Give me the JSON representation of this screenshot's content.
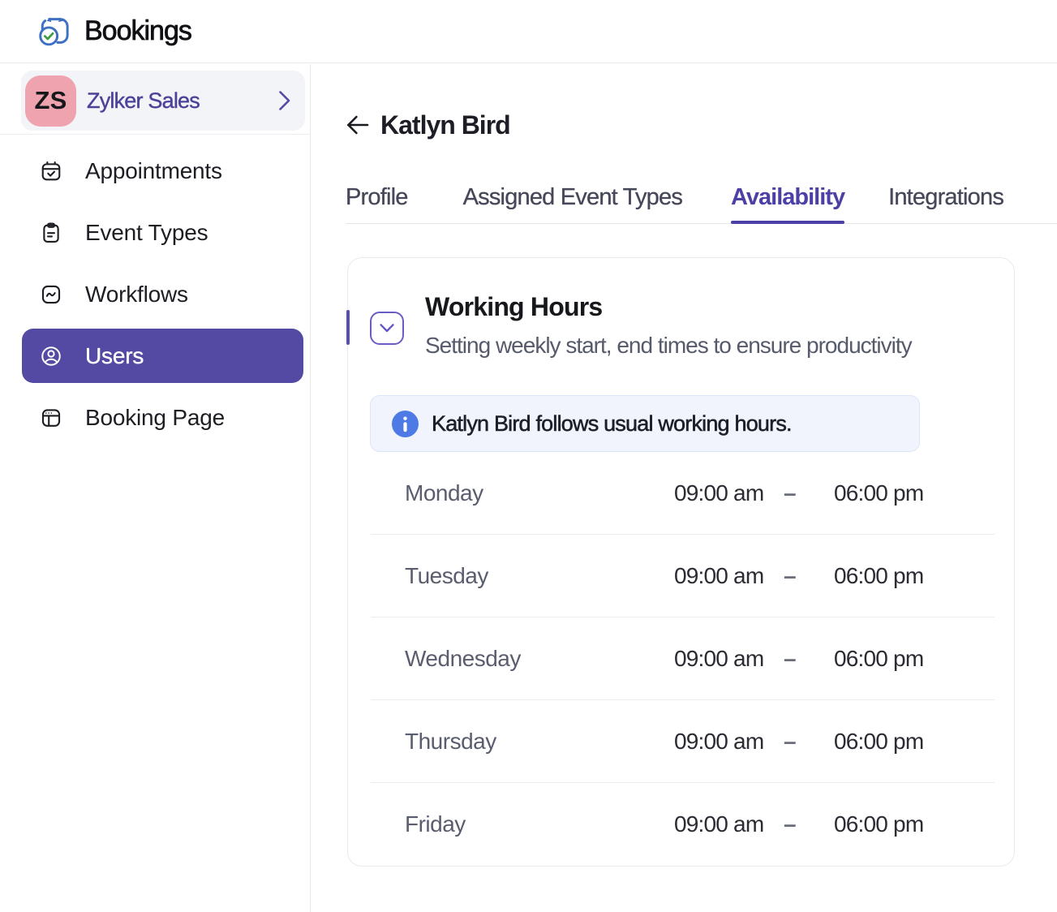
{
  "app": {
    "title": "Bookings"
  },
  "colors": {
    "primary_purple": "#544aa3",
    "tab_active_purple": "#4c3fa5",
    "avatar_pink": "#efa3ae",
    "notice_blue_bg": "#f1f4fc",
    "info_icon_blue": "#4d7ae5",
    "logo_blue": "#3d6fc3",
    "logo_check_green": "#3f9c42"
  },
  "sidebar": {
    "workspace": {
      "initials": "ZS",
      "name": "Zylker Sales"
    },
    "items": [
      {
        "label": "Appointments",
        "selected": false
      },
      {
        "label": "Event Types",
        "selected": false
      },
      {
        "label": "Workflows",
        "selected": false
      },
      {
        "label": "Users",
        "selected": true
      },
      {
        "label": "Booking Page",
        "selected": false
      }
    ]
  },
  "page": {
    "title": "Katlyn Bird"
  },
  "tabs": [
    {
      "label": "Profile",
      "active": false
    },
    {
      "label": "Assigned Event Types",
      "active": false
    },
    {
      "label": "Availability",
      "active": true
    },
    {
      "label": "Integrations",
      "active": false
    }
  ],
  "working_hours": {
    "title": "Working Hours",
    "subtitle": "Setting weekly start, end times to ensure productivity",
    "notice": "Katlyn Bird follows usual working hours.",
    "rows": [
      {
        "day": "Monday",
        "start": "09:00 am",
        "separator": "–",
        "end": "06:00 pm"
      },
      {
        "day": "Tuesday",
        "start": "09:00 am",
        "separator": "–",
        "end": "06:00 pm"
      },
      {
        "day": "Wednesday",
        "start": "09:00 am",
        "separator": "–",
        "end": "06:00 pm"
      },
      {
        "day": "Thursday",
        "start": "09:00 am",
        "separator": "–",
        "end": "06:00 pm"
      },
      {
        "day": "Friday",
        "start": "09:00 am",
        "separator": "–",
        "end": "06:00 pm"
      }
    ]
  }
}
